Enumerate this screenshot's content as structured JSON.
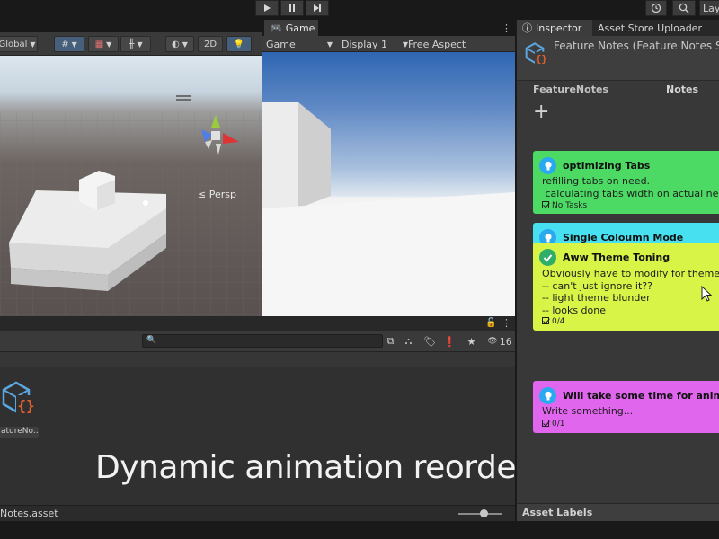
{
  "toolbar": {
    "play_icon": "play-icon",
    "pause_icon": "pause-icon",
    "step_icon": "step-icon",
    "layers_label": "Lay"
  },
  "scene": {
    "global_label": "Global",
    "mode_2d_label": "2D",
    "persp_label": "≤ Persp"
  },
  "game": {
    "tab_label": "Game",
    "view_label": "Game",
    "display_label": "Display 1",
    "aspect_label": "Free Aspect"
  },
  "project": {
    "search_placeholder": "",
    "count_label": "16",
    "asset_name": "atureNo...",
    "status_path": "Notes.asset",
    "caption": "Dynamic animation reordering"
  },
  "inspector": {
    "tab_label": "Inspector",
    "store_tab_label": "Asset Store Uploader",
    "title": "Feature Notes (Feature Notes SO)",
    "col_left": "FeatureNotes",
    "col_right": "Notes",
    "add_label": "+",
    "asset_labels": "Asset Labels"
  },
  "notes": [
    {
      "title": "optimizing Tabs",
      "body": "refilling tabs on need.\n calculating tabs width on actual need.",
      "tasks": "No Tasks",
      "color": "#4cd964",
      "icon_color": "#29a9f0"
    },
    {
      "title": "Single Coloumn Mode",
      "color": "#47e0f0",
      "icon_color": "#29a9f0"
    },
    {
      "title": "Aww Theme Toning",
      "body": "Obviously have to modify for theme changes.\n-- can't just ignore it??\n-- light theme blunder\n-- looks done",
      "tasks": "0/4",
      "color": "#d8f446",
      "icon_color": "#2fae6a"
    },
    {
      "title": "Will take some time for animations",
      "body": "Write something...",
      "tasks": "0/1",
      "color": "#e066ee",
      "icon_color": "#29a9f0"
    }
  ]
}
